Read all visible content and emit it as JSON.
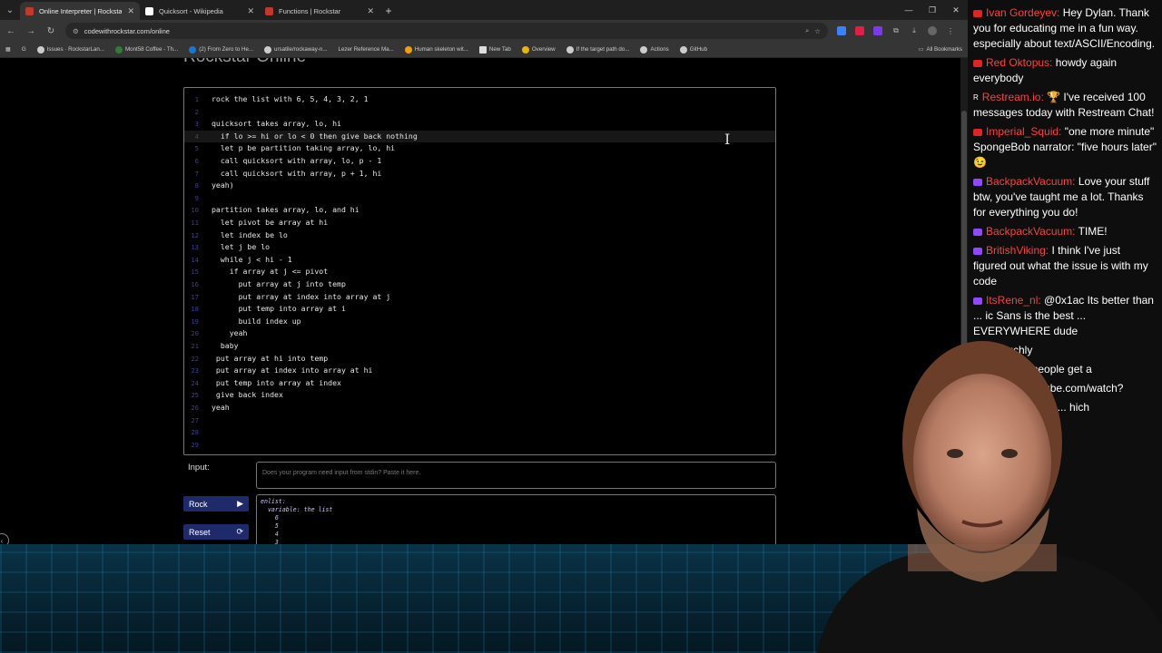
{
  "browser": {
    "tabs": [
      {
        "title": "Online Interpreter | Rockstar",
        "favicon_color": "#c0392b",
        "active": true
      },
      {
        "title": "Quicksort - Wikipedia",
        "favicon_color": "#ffffff",
        "active": false
      },
      {
        "title": "Functions | Rockstar",
        "favicon_color": "#c0392b",
        "active": false
      }
    ],
    "new_tab_symbol": "+",
    "url": "codewithrockstar.com/online",
    "bookmarks": [
      "G",
      "Issues · RockstarLan...",
      "Mont58 Coffee - Th...",
      "(2) From Zero to He...",
      "ursatile/rockaway-n...",
      "Lezer Reference Ma...",
      "Human skeleton wit...",
      "New Tab",
      "Overview",
      "If the target path do...",
      "Actions",
      "GitHub"
    ],
    "all_bookmarks": "All Bookmarks"
  },
  "page": {
    "title": "Rockstar Online",
    "code_lines": [
      {
        "n": "1",
        "text": "rock the list with 6, 5, 4, 3, 2, 1"
      },
      {
        "n": "2",
        "text": ""
      },
      {
        "n": "3",
        "text": "quicksort takes array, lo, hi"
      },
      {
        "n": "4",
        "text": "  if lo >= hi or lo < 0 then give back nothing"
      },
      {
        "n": "5",
        "text": "  let p be partition taking array, lo, hi"
      },
      {
        "n": "6",
        "text": "  call quicksort with array, lo, p - 1"
      },
      {
        "n": "7",
        "text": "  call quicksort with array, p + 1, hi"
      },
      {
        "n": "8",
        "text": "yeah)"
      },
      {
        "n": "9",
        "text": ""
      },
      {
        "n": "10",
        "text": "partition takes array, lo, and hi"
      },
      {
        "n": "11",
        "text": "  let pivot be array at hi"
      },
      {
        "n": "12",
        "text": "  let index be lo"
      },
      {
        "n": "13",
        "text": "  let j be lo"
      },
      {
        "n": "14",
        "text": "  while j < hi - 1"
      },
      {
        "n": "15",
        "text": "    if array at j <= pivot"
      },
      {
        "n": "16",
        "text": "      put array at j into temp"
      },
      {
        "n": "17",
        "text": "      put array at index into array at j"
      },
      {
        "n": "18",
        "text": "      put temp into array at i"
      },
      {
        "n": "19",
        "text": "      build index up"
      },
      {
        "n": "20",
        "text": "    yeah"
      },
      {
        "n": "21",
        "text": "  baby"
      },
      {
        "n": "22",
        "text": " put array at hi into temp"
      },
      {
        "n": "23",
        "text": " put array at index into array at hi"
      },
      {
        "n": "24",
        "text": " put temp into array at index"
      },
      {
        "n": "25",
        "text": " give back index"
      },
      {
        "n": "26",
        "text": "yeah"
      },
      {
        "n": "27",
        "text": ""
      },
      {
        "n": "28",
        "text": ""
      },
      {
        "n": "29",
        "text": ""
      }
    ],
    "highlighted_line": 4,
    "input_label": "Input:",
    "input_placeholder": "Does your program need input from stdin? Paste it here.",
    "rock_label": "Rock",
    "reset_label": "Reset",
    "output": "enlist:\n  variable: the list\n    6\n    5\n    4\n    3"
  },
  "chat": [
    {
      "platform": "youtube",
      "user": "Ivan Gordeyev:",
      "text": "Hey Dylan. Thank you for educating me in a fun way. especially about text/ASCII/Encoding."
    },
    {
      "platform": "youtube",
      "user": "Red Oktopus:",
      "text": "howdy again everybody"
    },
    {
      "platform": "restream",
      "user": "Restream.io:",
      "text": "🏆 I've received 100 messages today with Restream Chat!"
    },
    {
      "platform": "youtube",
      "user": "Imperial_Squid:",
      "text": "\"one more minute\" SpongeBob narrator: \"five hours later\" 😉"
    },
    {
      "platform": "twitch",
      "user": "BackpackVacuum:",
      "text": "Love your stuff btw, you've taught me a lot. Thanks for everything you do!"
    },
    {
      "platform": "twitch",
      "user": "BackpackVacuum:",
      "text": "TIME!"
    },
    {
      "platform": "twitch",
      "user": "BritishViking:",
      "text": "I think I've just figured out what the issue is with my code"
    },
    {
      "platform": "twitch",
      "user": "ItsRene_nl:",
      "text": "@0x1ac Its better than ... ic Sans is the best ... EVERYWHERE dude"
    },
    {
      "platform": "twitch",
      "user": "",
      "text": "ta muchly"
    },
    {
      "platform": "twitch",
      "user": "",
      "text": "fucksake people get a"
    },
    {
      "platform": "twitch",
      "user": "",
      "text": "zoxide: youtube.com/watch?"
    },
    {
      "platform": "twitch",
      "user": "",
      "text": "so many ... ng ... hich"
    }
  ]
}
